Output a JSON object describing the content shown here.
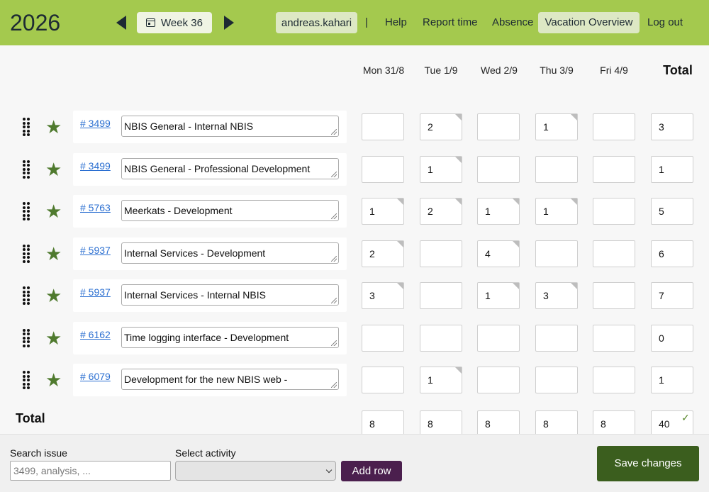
{
  "header": {
    "year": "2026",
    "week_label": "Week 36",
    "user": "andreas.kahari",
    "separator": "|",
    "nav": {
      "help": "Help",
      "report_time": "Report time",
      "absence": "Absence",
      "vacation_overview": "Vacation Overview",
      "log_out": "Log out"
    }
  },
  "days": [
    "Mon 31/8",
    "Tue 1/9",
    "Wed 2/9",
    "Thu 3/9",
    "Fri 4/9"
  ],
  "total_header": "Total",
  "rows": [
    {
      "issue": "# 3499",
      "activity": "NBIS General - Internal NBIS",
      "hours": [
        "",
        "2",
        "",
        "1",
        ""
      ],
      "total": "3"
    },
    {
      "issue": "# 3499",
      "activity": "NBIS General - Professional Development",
      "hours": [
        "",
        "1",
        "",
        "",
        ""
      ],
      "total": "1"
    },
    {
      "issue": "# 5763",
      "activity": "Meerkats - Development",
      "hours": [
        "1",
        "2",
        "1",
        "1",
        ""
      ],
      "total": "5"
    },
    {
      "issue": "# 5937",
      "activity": "Internal Services - Development",
      "hours": [
        "2",
        "",
        "4",
        "",
        ""
      ],
      "total": "6"
    },
    {
      "issue": "# 5937",
      "activity": "Internal Services - Internal NBIS",
      "hours": [
        "3",
        "",
        "1",
        "3",
        ""
      ],
      "total": "7"
    },
    {
      "issue": "# 6162",
      "activity": "Time logging interface - Development",
      "hours": [
        "",
        "",
        "",
        "",
        ""
      ],
      "total": "0"
    },
    {
      "issue": "# 6079",
      "activity": "Development for the new NBIS web -",
      "hours": [
        "",
        "1",
        "",
        "",
        ""
      ],
      "total": "1"
    }
  ],
  "totals": {
    "label": "Total",
    "days": [
      "8",
      "8",
      "8",
      "8",
      "8"
    ],
    "week_total": "40"
  },
  "footer": {
    "search_label": "Search issue",
    "search_placeholder": "3499, analysis, ...",
    "activity_label": "Select activity",
    "activity_value": "",
    "add_row": "Add row",
    "save_changes": "Save changes"
  },
  "colors": {
    "header_bg": "#a4c94e",
    "star": "#4f7a2e",
    "link": "#2b6fd1",
    "add_row_bg": "#4b1f4e",
    "save_bg": "#3b5e1e"
  }
}
